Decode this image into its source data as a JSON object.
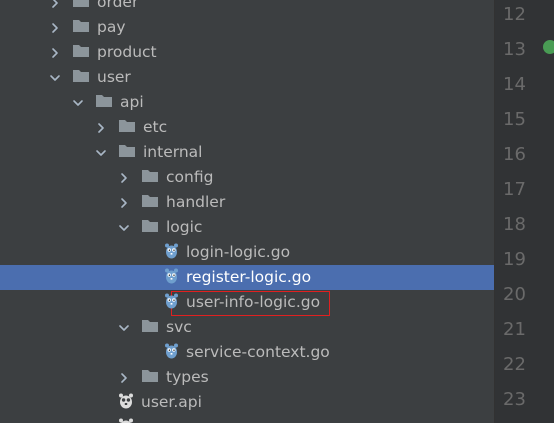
{
  "tree": {
    "items": [
      {
        "label": "order",
        "depth": 0,
        "kind": "folder",
        "expand": "collapsed"
      },
      {
        "label": "pay",
        "depth": 0,
        "kind": "folder",
        "expand": "collapsed"
      },
      {
        "label": "product",
        "depth": 0,
        "kind": "folder",
        "expand": "collapsed"
      },
      {
        "label": "user",
        "depth": 0,
        "kind": "folder",
        "expand": "expanded"
      },
      {
        "label": "api",
        "depth": 1,
        "kind": "folder",
        "expand": "expanded"
      },
      {
        "label": "etc",
        "depth": 2,
        "kind": "folder",
        "expand": "collapsed"
      },
      {
        "label": "internal",
        "depth": 2,
        "kind": "folder",
        "expand": "expanded"
      },
      {
        "label": "config",
        "depth": 3,
        "kind": "folder",
        "expand": "collapsed"
      },
      {
        "label": "handler",
        "depth": 3,
        "kind": "folder",
        "expand": "collapsed"
      },
      {
        "label": "logic",
        "depth": 3,
        "kind": "folder",
        "expand": "expanded"
      },
      {
        "label": "login-logic.go",
        "depth": 4,
        "kind": "gofile",
        "expand": "none"
      },
      {
        "label": "register-logic.go",
        "depth": 4,
        "kind": "gofile",
        "expand": "none",
        "selected": true
      },
      {
        "label": "user-info-logic.go",
        "depth": 4,
        "kind": "gofile",
        "expand": "none",
        "highlighted": true
      },
      {
        "label": "svc",
        "depth": 3,
        "kind": "folder",
        "expand": "expanded"
      },
      {
        "label": "service-context.go",
        "depth": 4,
        "kind": "gofile",
        "expand": "none"
      },
      {
        "label": "types",
        "depth": 3,
        "kind": "folder",
        "expand": "collapsed"
      },
      {
        "label": "user.api",
        "depth": 2,
        "kind": "apifile",
        "expand": "none"
      },
      {
        "label": "",
        "depth": 2,
        "kind": "apifile",
        "expand": "none"
      }
    ]
  },
  "gutter": {
    "line_numbers": [
      "12",
      "13",
      "14",
      "15",
      "16",
      "17",
      "18",
      "19",
      "20",
      "21",
      "22",
      "23"
    ]
  },
  "colors": {
    "panel_bg": "#3c3f41",
    "selection": "#4b6eaf",
    "folder": "#8c959b",
    "go_icon": "#6f9fce",
    "highlight_border": "#e02020",
    "gutter_marker": "#499c54"
  },
  "icons": {
    "folder": "folder-icon",
    "gofile": "go-file-icon",
    "apifile": "go-api-file-icon"
  }
}
